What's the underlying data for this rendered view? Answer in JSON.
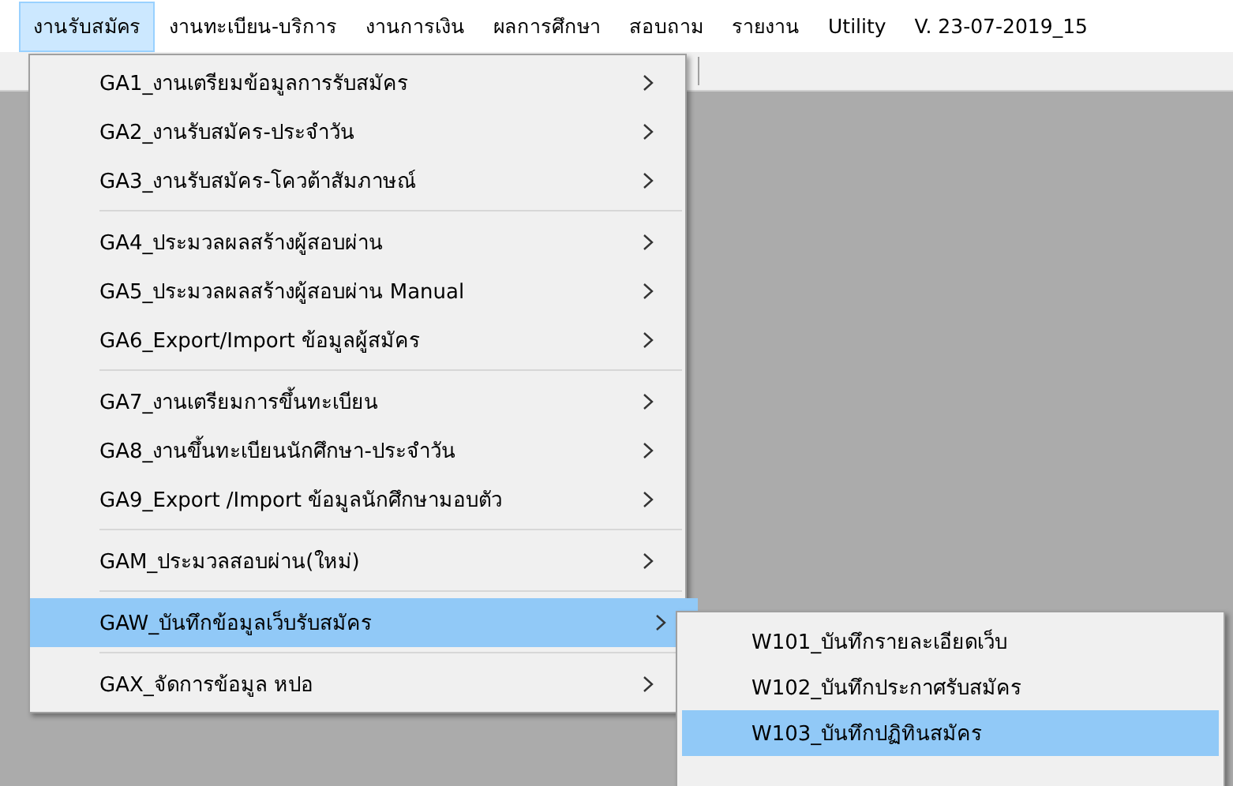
{
  "menubar": {
    "items": [
      {
        "label": "งานรับสมัคร",
        "selected": true
      },
      {
        "label": "งานทะเบียน-บริการ",
        "selected": false
      },
      {
        "label": "งานการเงิน",
        "selected": false
      },
      {
        "label": "ผลการศึกษา",
        "selected": false
      },
      {
        "label": "สอบถาม",
        "selected": false
      },
      {
        "label": "รายงาน",
        "selected": false
      },
      {
        "label": "Utility",
        "selected": false
      },
      {
        "label": "V. 23-07-2019_15",
        "selected": false
      }
    ]
  },
  "menu": {
    "groups": [
      [
        {
          "label": "GA1_งานเตรียมข้อมูลการรับสมัคร",
          "selected": false,
          "has_submenu": true
        },
        {
          "label": "GA2_งานรับสมัคร-ประจำวัน",
          "selected": false,
          "has_submenu": true
        },
        {
          "label": "GA3_งานรับสมัคร-โควต้าสัมภาษณ์",
          "selected": false,
          "has_submenu": true
        }
      ],
      [
        {
          "label": "GA4_ประมวลผลสร้างผู้สอบผ่าน",
          "selected": false,
          "has_submenu": true
        },
        {
          "label": "GA5_ประมวลผลสร้างผู้สอบผ่าน Manual",
          "selected": false,
          "has_submenu": true
        },
        {
          "label": "GA6_Export/Import ข้อมูลผู้สมัคร",
          "selected": false,
          "has_submenu": true
        }
      ],
      [
        {
          "label": "GA7_งานเตรียมการขึ้นทะเบียน",
          "selected": false,
          "has_submenu": true
        },
        {
          "label": "GA8_งานขึ้นทะเบียนนักศึกษา-ประจำวัน",
          "selected": false,
          "has_submenu": true
        },
        {
          "label": "GA9_Export /Import ข้อมูลนักศึกษามอบตัว",
          "selected": false,
          "has_submenu": true
        }
      ],
      [
        {
          "label": "GAM_ประมวลสอบผ่าน(ใหม่)",
          "selected": false,
          "has_submenu": true
        }
      ],
      [
        {
          "label": "GAW_บันทึกข้อมูลเว็บรับสมัคร",
          "selected": true,
          "has_submenu": true
        }
      ],
      [
        {
          "label": "GAX_จัดการข้อมูล หปอ",
          "selected": false,
          "has_submenu": true
        }
      ]
    ]
  },
  "submenu": {
    "items": [
      {
        "label": "W101_บันทึกรายละเอียดเว็บ",
        "selected": false
      },
      {
        "label": "W102_บันทึกประกาศรับสมัคร",
        "selected": false
      },
      {
        "label": "W103_บันทึกปฏิทินสมัคร",
        "selected": true
      }
    ]
  }
}
